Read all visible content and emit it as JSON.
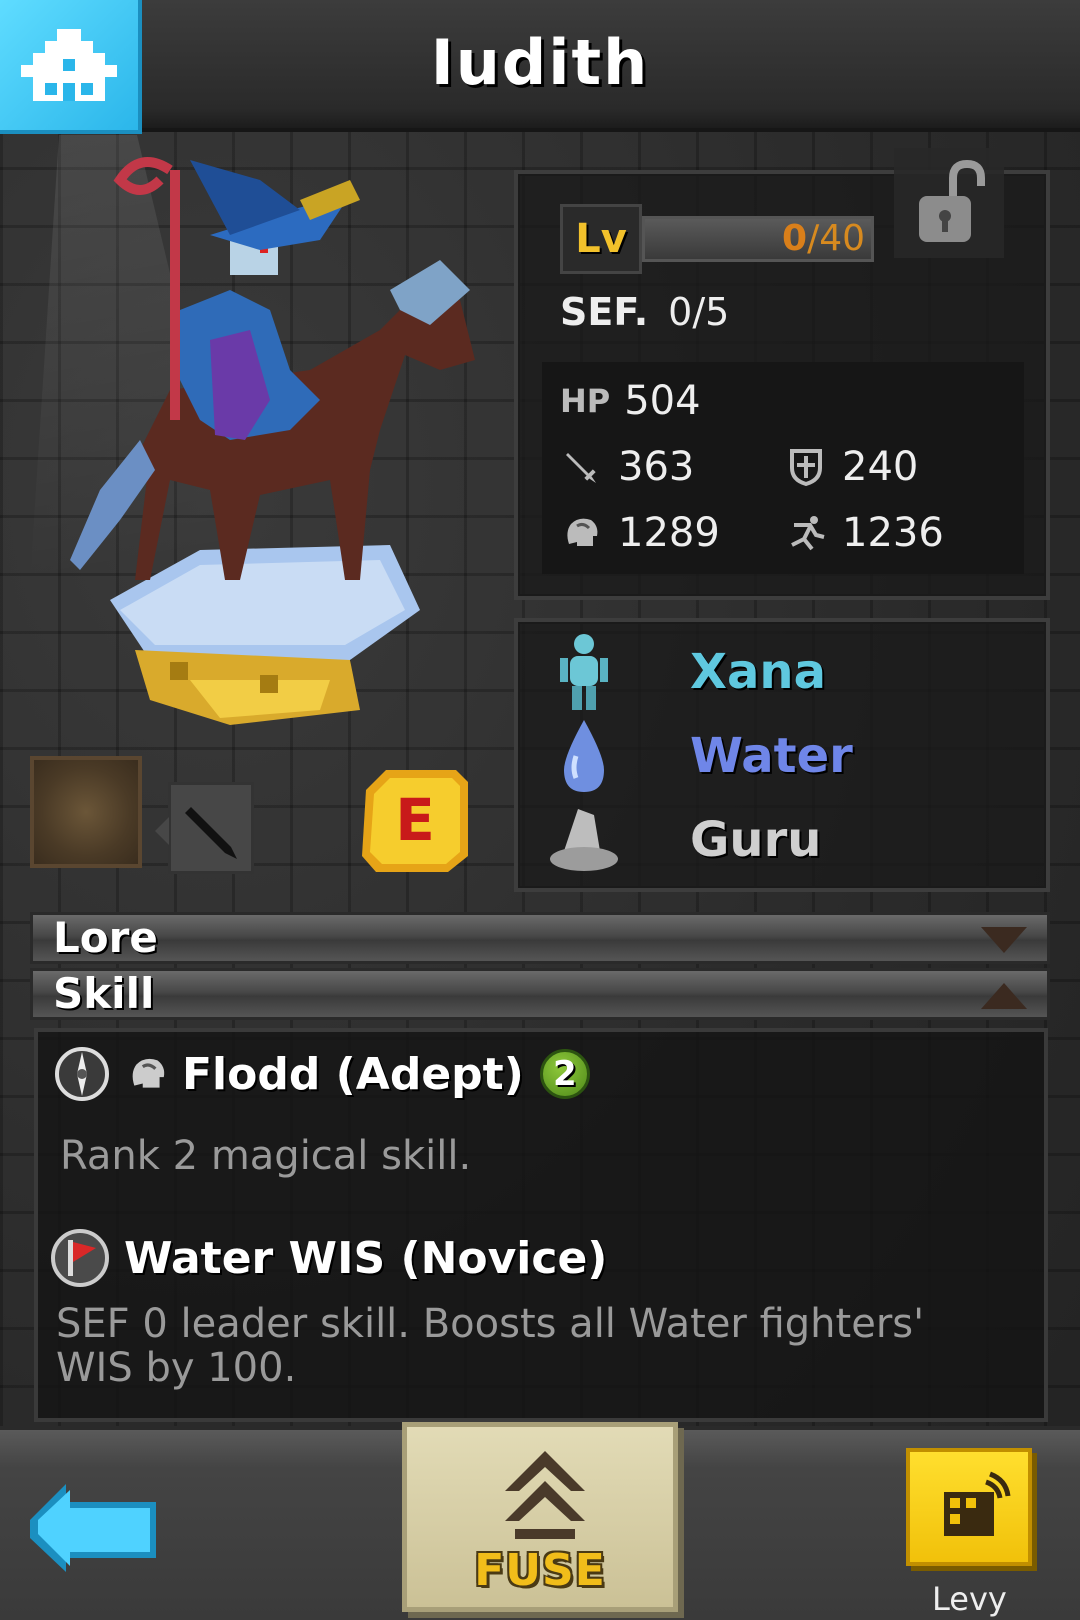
{
  "header": {
    "title": "Iudith",
    "home_icon": "home-icon"
  },
  "level": {
    "label": "Lv",
    "current": "0",
    "max": "/40",
    "progress_fraction": 0
  },
  "sef": {
    "label": "SEF.",
    "value": "0/5"
  },
  "stats": {
    "hp": {
      "label": "HP",
      "value": "504"
    },
    "attack": {
      "value": "363"
    },
    "defense": {
      "value": "240"
    },
    "wisdom": {
      "value": "1289"
    },
    "agility": {
      "value": "1236"
    }
  },
  "info": {
    "race": "Xana",
    "element": "Water",
    "class": "Guru",
    "colors": {
      "race": "#5fc8df",
      "element": "#6f86e8",
      "class": "#cfcfcf"
    }
  },
  "equipment": {
    "rank_letter": "E"
  },
  "sections": {
    "lore": "Lore",
    "skill": "Skill"
  },
  "skills": [
    {
      "name": "Flodd (Adept)",
      "rank": "2",
      "description": "Rank 2 magical skill."
    },
    {
      "name": "Water WIS (Novice)",
      "description_line1": "SEF 0 leader skill. Boosts all Water fighters'",
      "description_line2": "WIS by 100."
    }
  ],
  "bottom": {
    "fuse_label": "FUSE",
    "levy_label": "Levy"
  }
}
